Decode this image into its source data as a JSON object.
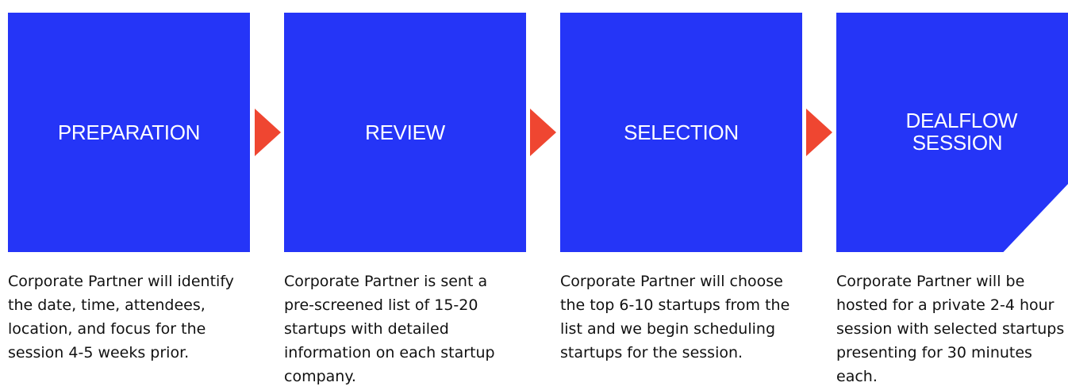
{
  "colors": {
    "box_fill": "#2535f7",
    "arrow_fill": "#ef4631",
    "title_text": "#ffffff",
    "description_text": "#111111"
  },
  "steps": [
    {
      "title": "PREPARATION",
      "description": "Corporate Partner will identify the date, time, attendees, location, and focus for the session 4-5 weeks prior."
    },
    {
      "title": "REVIEW",
      "description": "Corporate Partner is sent a pre-screened list of 15-20 startups with detailed information on each startup company."
    },
    {
      "title": "SELECTION",
      "description": "Corporate Partner will choose the top 6-10 startups from the list and we begin scheduling startups for the session."
    },
    {
      "title": "DEALFLOW SESSION",
      "description": "Corporate Partner will be hosted for a private 2-4 hour session with selected startups presenting for 30 minutes each."
    }
  ]
}
